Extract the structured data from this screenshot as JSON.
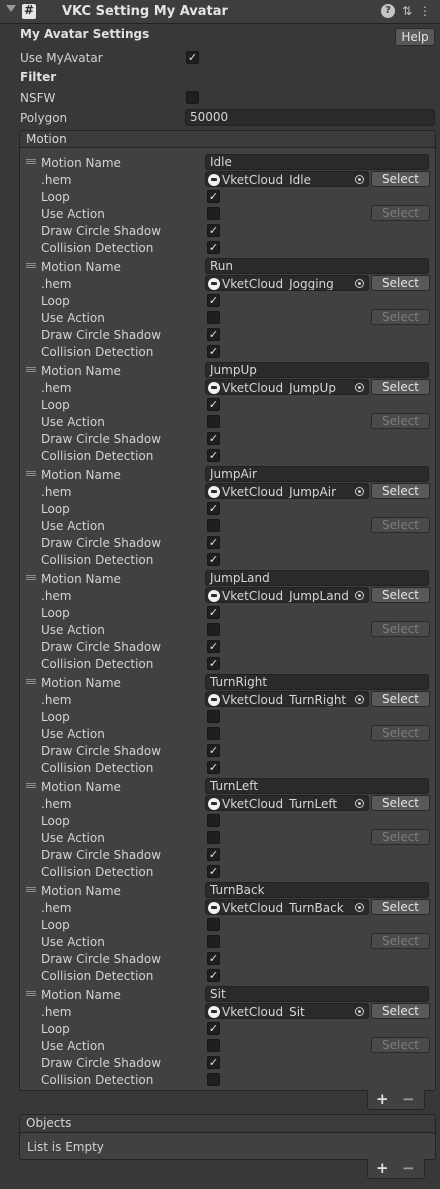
{
  "header": {
    "title": "VKC Setting My Avatar"
  },
  "my_avatar": {
    "section_label": "My Avatar Settings",
    "help_label": "Help",
    "use_label": "Use MyAvatar",
    "use_checked": true
  },
  "filter": {
    "section_label": "Filter",
    "nsfw_label": "NSFW",
    "nsfw_checked": false,
    "polygon_label": "Polygon",
    "polygon_value": "50000"
  },
  "motion": {
    "section_label": "Motion",
    "labels": {
      "name": "Motion Name",
      "hem": ".hem",
      "loop": "Loop",
      "use_action": "Use Action",
      "shadow": "Draw Circle Shadow",
      "collision": "Collision Detection",
      "select": "Select"
    },
    "items": [
      {
        "name": "Idle",
        "hem": "VketCloud_Idle",
        "loop": true,
        "use_action": false,
        "shadow": true,
        "collision": true
      },
      {
        "name": "Run",
        "hem": "VketCloud_Jogging",
        "loop": true,
        "use_action": false,
        "shadow": true,
        "collision": true
      },
      {
        "name": "JumpUp",
        "hem": "VketCloud_JumpUp",
        "loop": true,
        "use_action": false,
        "shadow": true,
        "collision": true
      },
      {
        "name": "JumpAir",
        "hem": "VketCloud_JumpAir",
        "loop": true,
        "use_action": false,
        "shadow": true,
        "collision": true
      },
      {
        "name": "JumpLand",
        "hem": "VketCloud_JumpLand",
        "loop": true,
        "use_action": false,
        "shadow": true,
        "collision": true
      },
      {
        "name": "TurnRight",
        "hem": "VketCloud_TurnRight",
        "loop": false,
        "use_action": false,
        "shadow": true,
        "collision": true
      },
      {
        "name": "TurnLeft",
        "hem": "VketCloud_TurnLeft",
        "loop": false,
        "use_action": false,
        "shadow": true,
        "collision": true
      },
      {
        "name": "TurnBack",
        "hem": "VketCloud_TurnBack",
        "loop": false,
        "use_action": false,
        "shadow": true,
        "collision": true
      },
      {
        "name": "Sit",
        "hem": "VketCloud_Sit",
        "loop": true,
        "use_action": false,
        "shadow": true,
        "collision": false
      }
    ],
    "add_label": "+",
    "remove_label": "−"
  },
  "objects": {
    "section_label": "Objects",
    "empty_text": "List is Empty",
    "add_label": "+",
    "remove_label": "−"
  },
  "header_icons": [
    "help-icon",
    "preset-icon",
    "more-icon"
  ],
  "check_glyph": "✓",
  "colors": {
    "background": "#383838",
    "field": "#2a2a2a",
    "button": "#585858"
  }
}
